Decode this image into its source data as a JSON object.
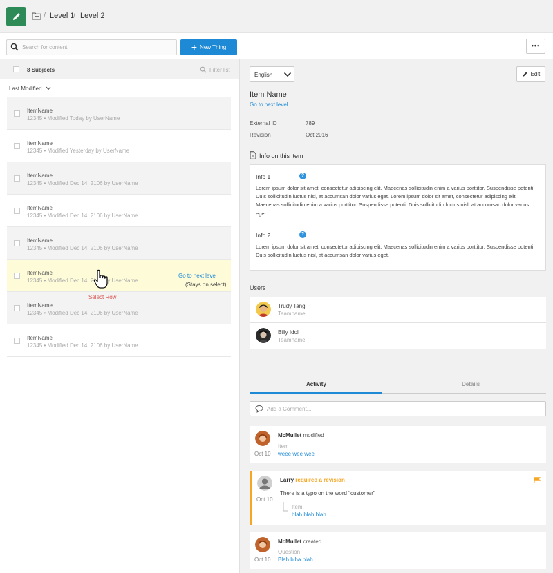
{
  "breadcrumb": {
    "level1": "Level 1",
    "level2": "Level 2",
    "sep": "/"
  },
  "toolbar": {
    "search_placeholder": "Search for content",
    "new_label": "New Thing",
    "more_label": "•••"
  },
  "list": {
    "count_label": "8 Subjects",
    "filter_label": "Filter list",
    "sort_label": "Last Modified",
    "rows": [
      {
        "name": "ItemName",
        "meta": "12345 •  Modified Today by UserName"
      },
      {
        "name": "ItemName",
        "meta": "12345 •  Modified Yesterday by UserName"
      },
      {
        "name": "ItemName",
        "meta": "12345 •  Modified Dec 14, 2106 by UserName"
      },
      {
        "name": "ItemName",
        "meta": "12345 •  Modified Dec 14, 2106 by UserName"
      },
      {
        "name": "ItemName",
        "meta": "12345 •  Modified Dec 14, 2106 by UserName"
      },
      {
        "name": "ItemName",
        "meta": "12345 •  Modified Dec 14, 2106 by UserName"
      },
      {
        "name": "ItemName",
        "meta": "12345 •  Modified Dec 14, 2106 by UserName"
      },
      {
        "name": "ItemName",
        "meta": "12345 •  Modified Dec 14, 2106 by UserName"
      }
    ],
    "goto_label": "Go to next level",
    "stays_label": "(Stays on select)",
    "select_row_label": "Select Row"
  },
  "detail": {
    "language": "English",
    "edit_label": "Edit",
    "item_name": "Item Name",
    "next_level_link": "Go to next level",
    "external_id_label": "External ID",
    "external_id": "789",
    "revision_label": "Revision",
    "revision": "Oct 2016",
    "info_title": "Info on this item",
    "info1_title": "Info 1",
    "info1_text": "Lorem ipsum dolor sit amet, consectetur adipiscing elit. Maecenas sollicitudin enim a varius porttitor. Suspendisse potenti. Duis sollicitudin luctus nisl, at accumsan dolor varius eget. Lorem ipsum dolor sit amet, consectetur adipiscing elit. Maecenas sollicitudin enim a varius porttitor. Suspendisse potenti. Duis sollicitudin luctus nisl, at accumsan dolor varius eget.",
    "info2_title": "Info 2",
    "info2_text": "Lorem ipsum dolor sit amet, consectetur adipiscing elit. Maecenas sollicitudin enim a varius porttitor. Suspendisse potenti. Duis sollicitudin luctus nisl, at accumsan dolor varius eget.",
    "users_label": "Users",
    "users": [
      {
        "name": "Trudy Tang",
        "team": "Teamname"
      },
      {
        "name": "Billy Idol",
        "team": "Teamname"
      }
    ],
    "tabs": {
      "activity": "Activity",
      "details": "Details"
    },
    "comment_placeholder": "Add a Comment...",
    "activity": [
      {
        "who": "McMullet",
        "verb": "modified",
        "sub": "Item",
        "value": "weee wee wee",
        "date": "Oct 10"
      },
      {
        "who": "Larry",
        "verb": "required a revision",
        "body": "There is a typo on the word \"customer\"",
        "sub": "Item",
        "value": "blah blah blah",
        "date": "Oct 10"
      },
      {
        "who": "McMullet",
        "verb": "created",
        "sub": "Question",
        "value": "Blah blha blah",
        "date": "Oct 10"
      }
    ]
  },
  "colors": {
    "brand_green": "#2e8b57",
    "accent_blue": "#1e8ad6",
    "flag_orange": "#f5a623",
    "select_yellow": "#fefbd8",
    "annotation_red": "#d9534f"
  }
}
